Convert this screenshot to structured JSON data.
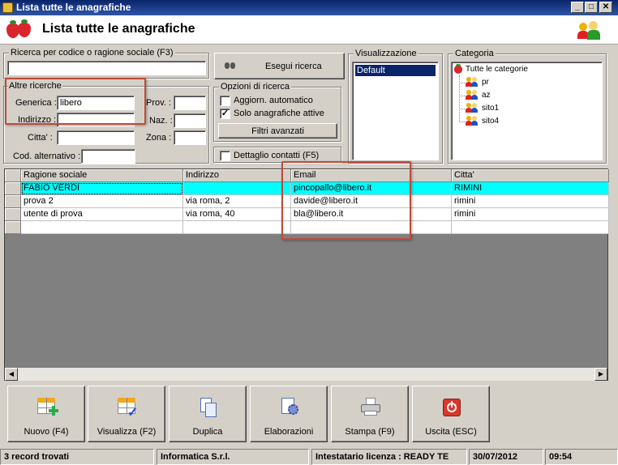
{
  "window": {
    "title": "Lista tutte le anagrafiche",
    "buttons": {
      "minimize": "_",
      "maximize": "□",
      "close": "✕"
    }
  },
  "header": {
    "title": "Lista tutte le anagrafiche"
  },
  "search": {
    "legend": "Ricerca per codice o ragione sociale (F3)",
    "value": "",
    "button_label": "Esegui ricerca"
  },
  "other": {
    "legend": "Altre ricerche",
    "generica": {
      "label": "Generica :",
      "value": "libero"
    },
    "indirizzo": {
      "label": "Indirizzo :",
      "value": ""
    },
    "citta": {
      "label": "Citta' :",
      "value": ""
    },
    "cod_alt": {
      "label": "Cod. alternativo :",
      "value": ""
    },
    "prov": {
      "label": "Prov. :",
      "value": ""
    },
    "naz": {
      "label": "Naz. :",
      "value": ""
    },
    "zona": {
      "label": "Zona :",
      "value": ""
    }
  },
  "options": {
    "legend": "Opzioni di ricerca",
    "auto_update": {
      "label": "Aggiorn. automatico",
      "checked": false,
      "mark": ""
    },
    "active_only": {
      "label": "Solo anagrafiche attive",
      "checked": true,
      "mark": "✓"
    },
    "advanced_filters": "Filtri avanzati",
    "contact_detail": {
      "label": "Dettaglio contatti (F5)",
      "checked": false,
      "mark": ""
    }
  },
  "view": {
    "legend": "Visualizzazione",
    "selected": "Default"
  },
  "category": {
    "legend": "Categoria",
    "root": "Tutte le categorie",
    "items": [
      "pr",
      "az",
      "sito1",
      "sito4"
    ]
  },
  "grid": {
    "columns": [
      "Ragione sociale",
      "Indirizzo",
      "Email",
      "Citta'"
    ],
    "rows": [
      [
        "FABIO VERDI",
        "",
        "pincopallo@libero.it",
        "RIMINI"
      ],
      [
        "prova 2",
        "via roma, 2",
        "davide@libero.it",
        "rimini"
      ],
      [
        "utente di prova",
        "via roma, 40",
        "bla@libero.it",
        "rimini"
      ]
    ]
  },
  "toolbar": {
    "new": "Nuovo (F4)",
    "view": "Visualizza (F2)",
    "duplicate": "Duplica",
    "process": "Elaborazioni",
    "print": "Stampa (F9)",
    "exit": "Uscita (ESC)"
  },
  "status": {
    "records": "3 record trovati",
    "company": "Informatica S.r.l.",
    "license": "Intestatario licenza : READY TE",
    "date": "30/07/2012",
    "time": "09:54"
  },
  "colors": {
    "titlebar": "#0a246a",
    "selected_row": "#00ffff",
    "highlight_box": "#c04a3a",
    "exit_red": "#d9372b"
  }
}
